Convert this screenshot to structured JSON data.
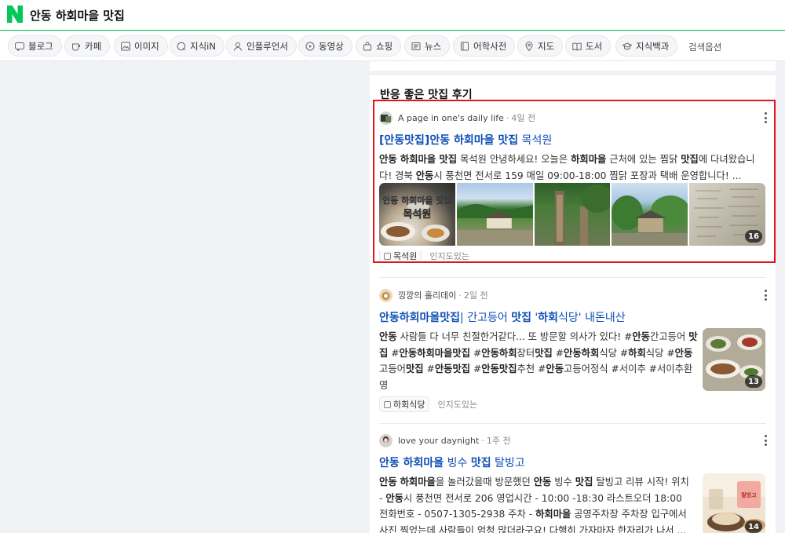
{
  "search": {
    "query": "안동 하회마을 맛집"
  },
  "tabs": [
    {
      "label": "블로그",
      "icon": "blog-icon"
    },
    {
      "label": "카페",
      "icon": "cafe-icon"
    },
    {
      "label": "이미지",
      "icon": "image-icon"
    },
    {
      "label": "지식iN",
      "icon": "knowledge-icon"
    },
    {
      "label": "인플루언서",
      "icon": "influencer-icon"
    },
    {
      "label": "동영상",
      "icon": "video-icon"
    },
    {
      "label": "쇼핑",
      "icon": "shopping-icon"
    },
    {
      "label": "뉴스",
      "icon": "news-icon"
    },
    {
      "label": "어학사전",
      "icon": "dictionary-icon"
    },
    {
      "label": "지도",
      "icon": "map-pin-icon"
    },
    {
      "label": "도서",
      "icon": "book-icon"
    },
    {
      "label": "지식백과",
      "icon": "encyclopedia-icon"
    }
  ],
  "search_options": "검색옵션",
  "section": {
    "title": "반응 좋은 맛집 후기"
  },
  "posts": [
    {
      "author": "A page in one's daily life",
      "time": "4일 전",
      "title_parts": [
        "[안동맛집]안동 하회마을 맛집",
        " 목석원"
      ],
      "desc": [
        "안동 하회마을 맛집",
        " 목석원 안녕하세요! 오늘은 ",
        "하회마을",
        " 근처에 있는 찜닭 ",
        "맛집",
        "에 다녀왔습니다! 경북 ",
        "안동",
        "시 풍천면 전서로 159 매일 09:00-18:00 찜닭 포장과 택배 운영합니다! ..."
      ],
      "image_overlay_text": [
        "안동 하회마을 맛집",
        "목석원"
      ],
      "image_count": "16",
      "place": "목석원",
      "place_extra": "인지도있는"
    },
    {
      "author": "낑깡의 홀리데이",
      "time": "2일 전",
      "title_parts": [
        "안동하회마을맛집",
        "| 간고등어 ",
        "맛집",
        " '",
        "하회",
        "식당' 내돈내산"
      ],
      "desc": [
        "안동",
        " 사람들 다 너무 친절한거같다... 또 방문할 의사가 있다! #",
        "안동",
        "간고등어",
        " ",
        "맛집",
        " #",
        "안동하회마을맛집",
        " #",
        "안동하회",
        "장터",
        "맛집",
        " #",
        "안동하회",
        "식당 #",
        "하회",
        "식당 #",
        "안동",
        "고등어",
        "맛집",
        " #",
        "안동맛집",
        " #",
        "안동맛집",
        "추천 #",
        "안동",
        "고등어정식 #서이추 #서이추환영"
      ],
      "image_count": "13",
      "place": "하회식당",
      "place_extra": "인지도있는"
    },
    {
      "author": "love your daynight",
      "time": "1주 전",
      "title_parts": [
        "안동 하회마을",
        " 빙수 ",
        "맛집",
        " 탈빙고"
      ],
      "desc": [
        "안동",
        " ",
        "하회마을",
        "을 놀러갔을때 방문했던 ",
        "안동",
        " 빙수 ",
        "맛집",
        " 탈빙고 리뷰 시작! 위치 - ",
        "안동",
        "시 풍천면 전서로 206 영업시간 - 10:00 -18:30 라스트오더 18:00 전화번호 - 0507-1305-2938 주차 - ",
        "하회마을",
        " 공영주차장 주차장 입구에서 사진 찍었는데 사람들이 엄청 많더라구요! 다행히 가자마자 한자리가 나서 ..."
      ],
      "image_count": "14"
    }
  ],
  "colors": {
    "brand": "#03c75a",
    "link": "#0d4eb5",
    "highlight": "#e0151b"
  }
}
